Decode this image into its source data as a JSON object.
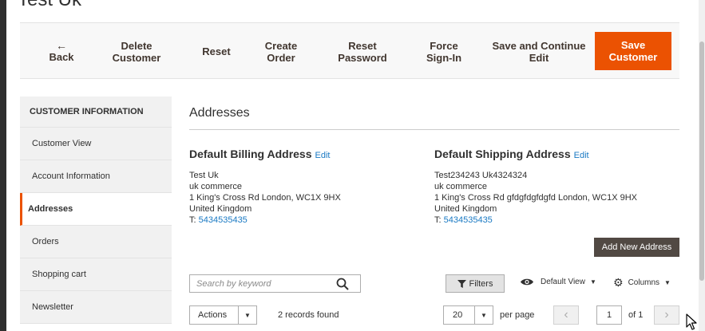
{
  "page": {
    "title": "Test Uk"
  },
  "toolbar": {
    "back": {
      "icon": "arrow-left-icon",
      "glyph": "←",
      "label": "Back"
    },
    "delete_line1": "Delete",
    "delete_line2": "Customer",
    "reset": "Reset",
    "create_line1": "Create",
    "create_line2": "Order",
    "resetpw_line1": "Reset",
    "resetpw_line2": "Password",
    "force_line1": "Force",
    "force_line2": "Sign-In",
    "savecont_line1": "Save and Continue",
    "savecont_line2": "Edit",
    "save_line1": "Save",
    "save_line2": "Customer"
  },
  "sidebar": {
    "heading": "CUSTOMER INFORMATION",
    "items": [
      {
        "label": "Customer View",
        "active": false
      },
      {
        "label": "Account Information",
        "active": false
      },
      {
        "label": "Addresses",
        "active": true
      },
      {
        "label": "Orders",
        "active": false
      },
      {
        "label": "Shopping cart",
        "active": false
      },
      {
        "label": "Newsletter",
        "active": false
      }
    ]
  },
  "addresses": {
    "section_title": "Addresses",
    "billing": {
      "title": "Default Billing Address",
      "edit": "Edit",
      "name": "Test Uk",
      "company": "uk commerce",
      "street": "1 King's Cross Rd London, WC1X 9HX",
      "country": "United Kingdom",
      "phone_prefix": "T: ",
      "phone": "5434535435"
    },
    "shipping": {
      "title": "Default Shipping Address",
      "edit": "Edit",
      "name": "Test234243 Uk4324324",
      "company": "uk commerce",
      "street": "1 King's Cross Rd gfdgfdgfdgfd London, WC1X 9HX",
      "country": "United Kingdom",
      "phone_prefix": "T: ",
      "phone": "5434535435"
    },
    "add_new": "Add New Address"
  },
  "grid": {
    "search_placeholder": "Search by keyword",
    "filters": "Filters",
    "view": "Default View",
    "columns": "Columns",
    "actions": "Actions",
    "records": "2 records found",
    "per_page_value": "20",
    "per_page_label": "per page",
    "page_value": "1",
    "page_of": "of 1"
  },
  "colors": {
    "primary": "#eb5202",
    "dark_button": "#514943",
    "link": "#1979c3"
  }
}
